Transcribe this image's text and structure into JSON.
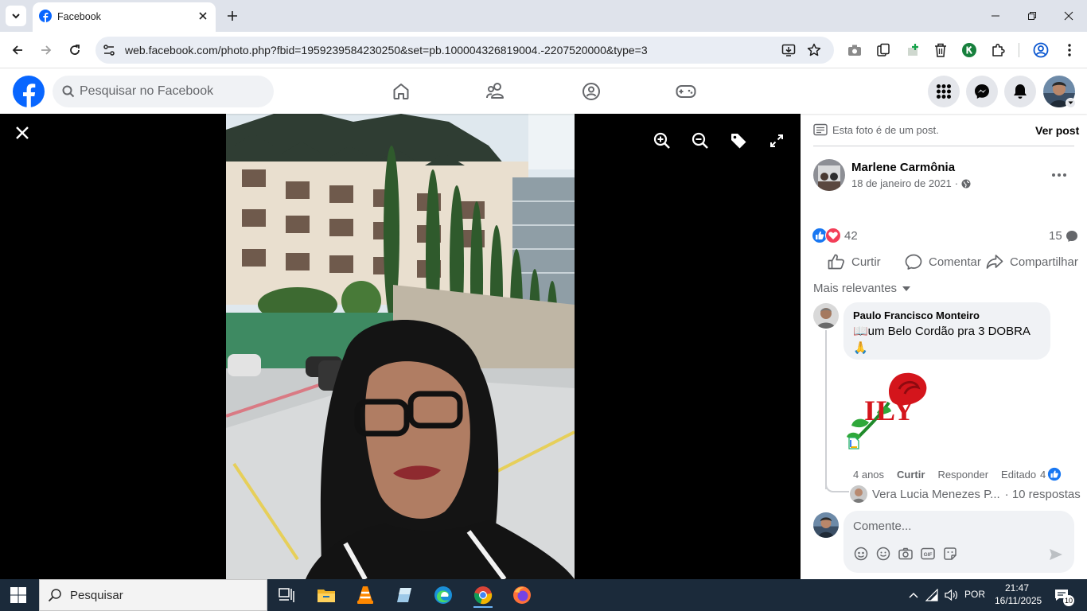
{
  "browser": {
    "tab_title": "Facebook",
    "url": "web.facebook.com/photo.php?fbid=1959239584230250&set=pb.100004326819004.-2207520000&type=3"
  },
  "facebook": {
    "search_placeholder": "Pesquisar no Facebook",
    "brand_color": "#0866ff"
  },
  "post": {
    "note": "Esta foto é de um post.",
    "see_post": "Ver post",
    "author": "Marlene Carmônia",
    "date": "18 de janeiro de 2021",
    "date_separator": "·",
    "reaction_count": "42",
    "comment_count": "15",
    "actions": {
      "like": "Curtir",
      "comment": "Comentar",
      "share": "Compartilhar"
    },
    "sort_label": "Mais relevantes"
  },
  "comment": {
    "author": "Paulo Francisco Monteiro",
    "text": "📖um Belo Cordão pra 3 DOBRA 🙏",
    "sticker_text": "ILY",
    "age": "4 anos",
    "like": "Curtir",
    "reply": "Responder",
    "edited": "Editado",
    "likes": "4",
    "replies_author": "Vera Lucia Menezes P...",
    "replies_count": "· 10 respostas"
  },
  "composer": {
    "placeholder": "Comente..."
  },
  "taskbar": {
    "search_placeholder": "Pesquisar",
    "lang": "POR",
    "time": "21:47",
    "date": "16/11/2025",
    "notifications": "10"
  }
}
